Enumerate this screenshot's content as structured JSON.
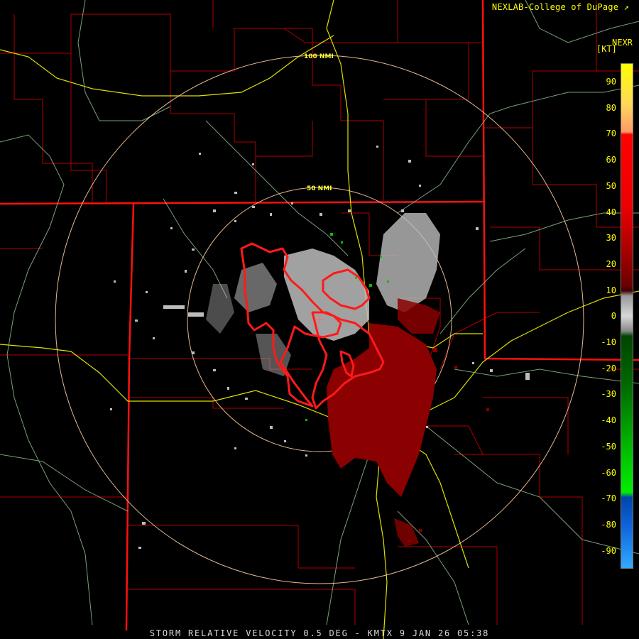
{
  "header": {
    "credit": "NEXLAB-College of DuPage",
    "credit_icon": "external-link-icon",
    "product": "NEXR",
    "units": "[KT]"
  },
  "map": {
    "range_rings": [
      {
        "label": "100 NMI"
      },
      {
        "label": "50 NMI"
      }
    ]
  },
  "legend": {
    "title": "[KT]",
    "ticks": [
      "90",
      "80",
      "70",
      "60",
      "50",
      "40",
      "30",
      "20",
      "10",
      "0",
      "-10",
      "-20",
      "-30",
      "-40",
      "-50",
      "-60",
      "-70",
      "-80",
      "-90"
    ],
    "colors": {
      "high_yellow": "#ffff00",
      "orange": "#ff9933",
      "salmon": "#ff9977",
      "red": "#ff0000",
      "dark_red": "#7a0000",
      "gray": "#aaaaaa",
      "dark_green": "#006600",
      "green": "#00e000",
      "blue": "#0055cc",
      "light_blue": "#33aaff"
    }
  },
  "footer": {
    "caption": "STORM RELATIVE VELOCITY 0.5 DEG - KMTX 9 JAN 26 05:38"
  }
}
